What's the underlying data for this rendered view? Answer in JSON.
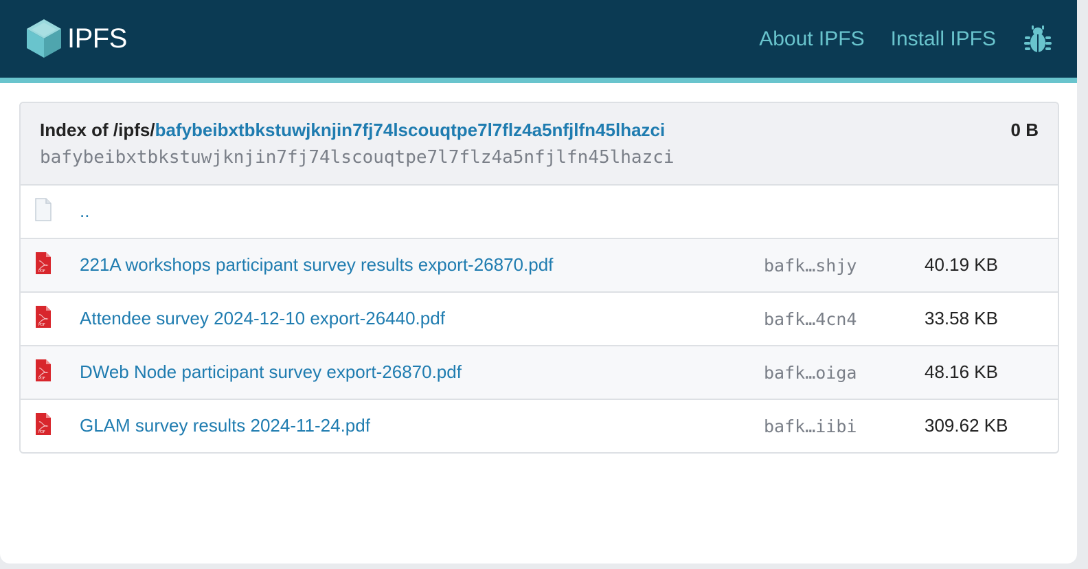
{
  "header": {
    "logo_text": "IPFS",
    "nav": [
      {
        "label": "About IPFS"
      },
      {
        "label": "Install IPFS"
      }
    ],
    "bug_icon": "bug-icon",
    "colors": {
      "bar": "#0b3a53",
      "accent": "#69c4cd"
    }
  },
  "listing": {
    "index_prefix": "Index of /ipfs/",
    "cid": "bafybeibxtbkstuwjknjin7fj74lscouqtpe7l7flz4a5nfjlfn45lhazci",
    "cid_mono": "bafybeibxtbkstuwjknjin7fj74lscouqtpe7l7flz4a5nfjlfn45lhazci",
    "total_size": "0 B",
    "parent": {
      "name": "..",
      "icon": "file-icon"
    },
    "files": [
      {
        "name": "221A workshops participant survey results export-26870.pdf",
        "hash": "bafk…shjy",
        "size": "40.19 KB",
        "icon": "pdf-icon"
      },
      {
        "name": "Attendee survey 2024-12-10 export-26440.pdf",
        "hash": "bafk…4cn4",
        "size": "33.58 KB",
        "icon": "pdf-icon"
      },
      {
        "name": "DWeb Node participant survey export-26870.pdf",
        "hash": "bafk…oiga",
        "size": "48.16 KB",
        "icon": "pdf-icon"
      },
      {
        "name": "GLAM survey results 2024-11-24.pdf",
        "hash": "bafk…iibi",
        "size": "309.62 KB",
        "icon": "pdf-icon"
      }
    ]
  }
}
